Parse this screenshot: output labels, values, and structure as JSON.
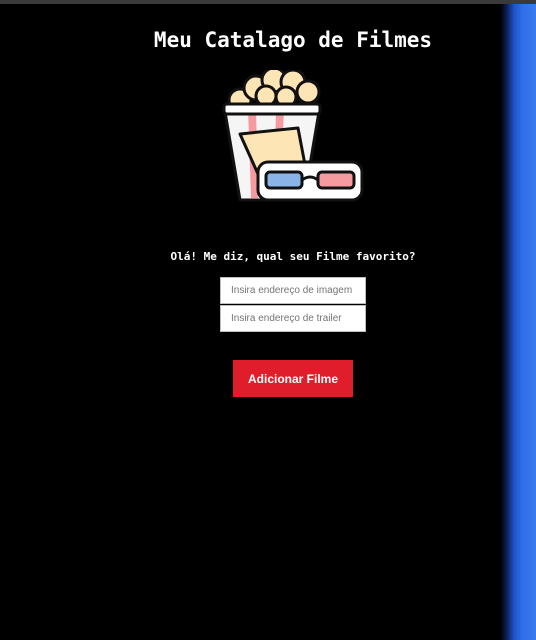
{
  "header": {
    "title": "Meu Catalago de Filmes"
  },
  "logo": {
    "icon": "popcorn-3d-glasses-icon"
  },
  "form": {
    "question": "Olá! Me diz, qual seu Filme favorito?",
    "image_input": {
      "value": "",
      "placeholder": "Insira endereço de imagem"
    },
    "trailer_input": {
      "value": "",
      "placeholder": "Insira endereço de trailer"
    },
    "submit_label": "Adicionar Filme"
  },
  "colors": {
    "background": "#000000",
    "button": "#e01e2b",
    "text": "#ffffff"
  }
}
